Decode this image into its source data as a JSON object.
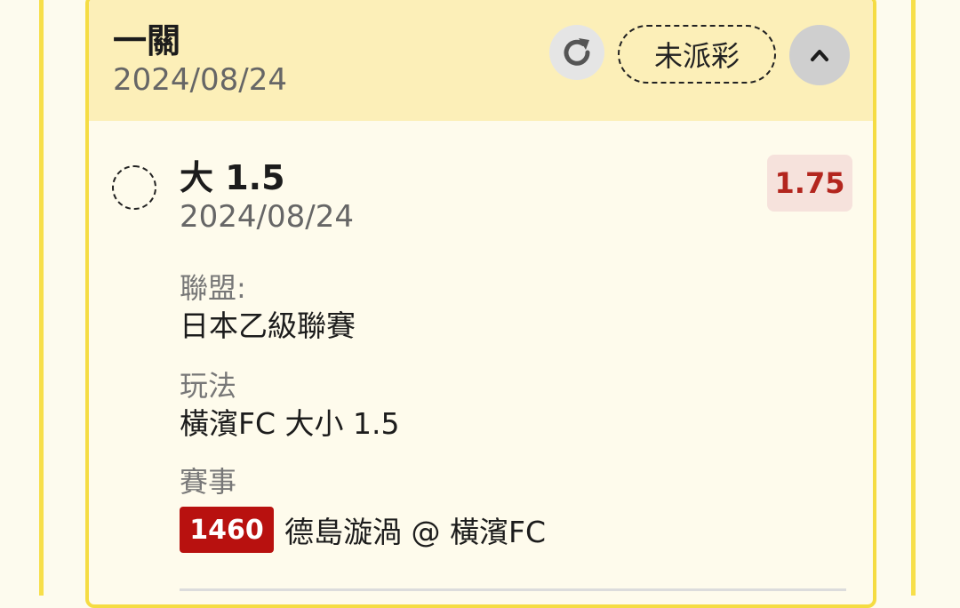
{
  "header": {
    "title": "一關",
    "date": "2024/08/24",
    "status_label": "未派彩",
    "refresh_icon": "refresh-icon",
    "collapse_icon": "chevron-up-icon"
  },
  "selection": {
    "title": "大 1.5",
    "date": "2024/08/24",
    "odds": "1.75"
  },
  "details": {
    "league_label": "聯盟:",
    "league_value": "日本乙級聯賽",
    "play_label": "玩法",
    "play_value": "橫濱FC 大小 1.5",
    "match_label": "賽事",
    "match_id": "1460",
    "match_teams": "德島漩渦 @ 橫濱FC"
  },
  "colors": {
    "accent_yellow": "#f5dc43",
    "header_bg": "#fcefb8",
    "odds_red": "#b3261e",
    "match_id_bg": "#b8110f"
  }
}
